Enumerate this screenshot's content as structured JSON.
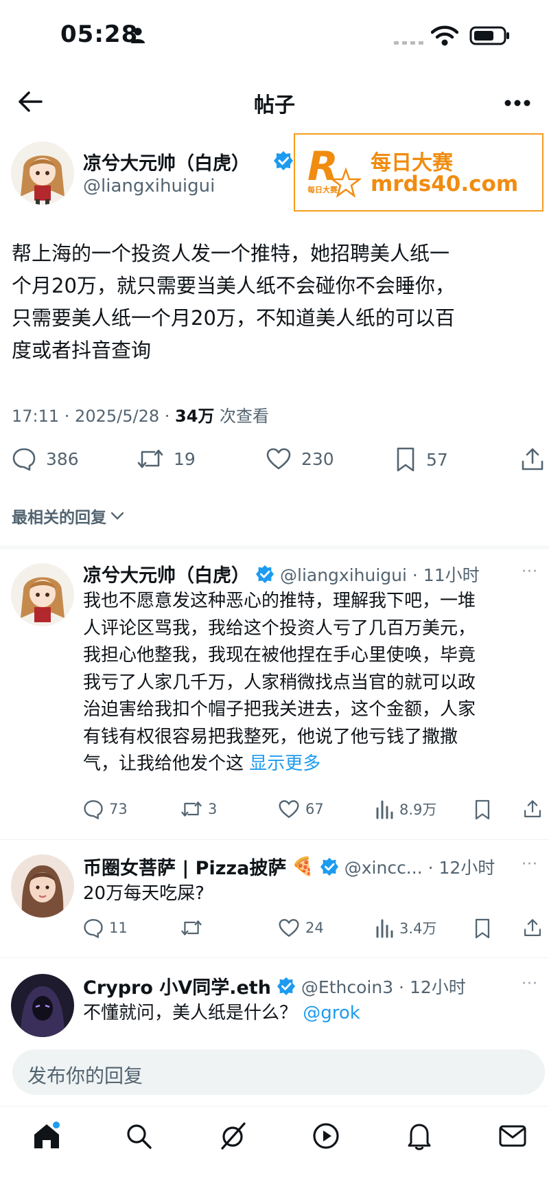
{
  "status": {
    "time": "05:28"
  },
  "header": {
    "title": "帖子"
  },
  "ad": {
    "line1": "每日大赛",
    "line2": "mrds40.com",
    "logo_letter": "R",
    "logo_sub": "每日大赛"
  },
  "post": {
    "author_name": "凉兮大元帅（白虎）",
    "author_handle": "@liangxihuigui",
    "text_lines": [
      "帮上海的一个投资人发一个推特，她招聘美人纸一",
      "个月20万，就只需要当美人纸不会碰你不会睡你，",
      "只需要美人纸一个月20万，不知道美人纸的可以百",
      "度或者抖音查询"
    ],
    "time_date": "17:11 · 2025/5/28 · ",
    "views": "34万",
    "views_label": " 次查看",
    "replies": "386",
    "retweets": "19",
    "likes": "230",
    "bookmarks": "57"
  },
  "sort": {
    "label": "最相关的回复"
  },
  "replies": [
    {
      "name": "凉兮大元帅（白虎）",
      "handle_time": "@liangxihuigui · 11小时",
      "lines": [
        "我也不愿意发这种恶心的推特，理解我下吧，一堆",
        "人评论区骂我，我给这个投资人亏了几百万美元，",
        "我担心他整我，我现在被他捏在手心里使唤，毕竟",
        "我亏了人家几千万，人家稍微找点当官的就可以政",
        "治迫害给我扣个帽子把我关进去，这个金额，人家",
        "有钱有权很容易把我整死，他说了他亏钱了撒撒"
      ],
      "last_line": "气，让我给他发个这 ",
      "show_more": "显示更多",
      "comments": "73",
      "retweets": "3",
      "likes": "67",
      "views": "8.9万"
    },
    {
      "name": "币圈女菩萨 | Pizza披萨",
      "handle_time": "@xincc... · 12小时",
      "text": "20万每天吃屎?",
      "comments": "11",
      "retweets": "",
      "likes": "24",
      "views": "3.4万"
    },
    {
      "name": "Crypro 小V同学.eth",
      "handle_time": "@Ethcoin3 · 12小时",
      "text": "不懂就问，美人纸是什么？ ",
      "mention": "@grok"
    }
  ],
  "compose": {
    "placeholder": "发布你的回复"
  },
  "colors": {
    "accent": "#1d9bf0",
    "ad_orange": "#f08c10",
    "text": "#0f1419",
    "muted": "#536471"
  },
  "nav": [
    "home-icon",
    "search-icon",
    "grok-icon",
    "video-icon",
    "bell-icon",
    "mail-icon"
  ]
}
